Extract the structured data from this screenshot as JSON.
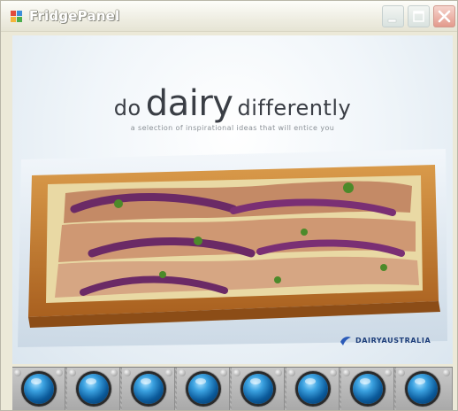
{
  "window": {
    "title": "FridgePanel",
    "icons": {
      "app": "window-app-icon",
      "minimize": "minimize-icon",
      "maximize": "maximize-icon",
      "close": "close-icon"
    },
    "colors": {
      "close_button": "#e39a8c",
      "titlebar": "#f2f1e8"
    }
  },
  "photo": {
    "headline_prefix": "do",
    "headline_main": "dairy",
    "headline_suffix": "differently",
    "tagline": "a selection of inspirational ideas that will entice you",
    "brand": "DAIRYAUSTRALIA",
    "subject": "tart"
  },
  "bottom_panel": {
    "buttons": [
      {
        "icon": "blue-orb-button-icon"
      },
      {
        "icon": "blue-orb-button-icon"
      },
      {
        "icon": "blue-orb-button-icon"
      },
      {
        "icon": "blue-orb-button-icon"
      },
      {
        "icon": "blue-orb-button-icon"
      },
      {
        "icon": "blue-orb-button-icon"
      },
      {
        "icon": "blue-orb-button-icon"
      },
      {
        "icon": "blue-orb-button-icon"
      }
    ],
    "colors": {
      "orb": "#0b5a9a",
      "panel": "#b5b5b5"
    }
  }
}
